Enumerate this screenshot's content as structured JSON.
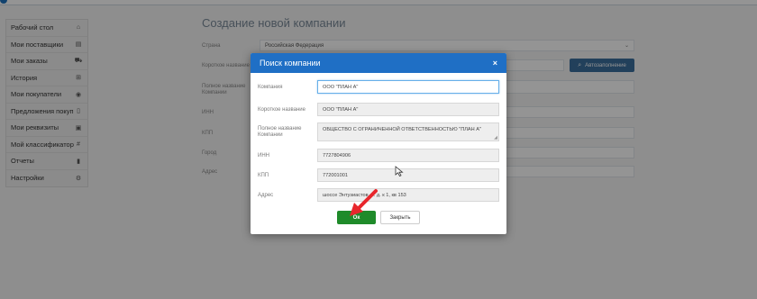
{
  "sidebar": {
    "items": [
      {
        "label": "Рабочий стол",
        "icon": "home-icon"
      },
      {
        "label": "Мои поставщики",
        "icon": "document-icon"
      },
      {
        "label": "Мои заказы",
        "icon": "cart-icon"
      },
      {
        "label": "История",
        "icon": "basket-icon"
      },
      {
        "label": "Мои покупатели",
        "icon": "eye-icon"
      },
      {
        "label": "Предложения покуп...",
        "icon": "file-icon"
      },
      {
        "label": "Мои реквизиты",
        "icon": "id-card-icon"
      },
      {
        "label": "Мой классификатор",
        "icon": "hash-icon"
      },
      {
        "label": "Отчеты",
        "icon": "report-icon"
      },
      {
        "label": "Настройки",
        "icon": "gears-icon"
      }
    ]
  },
  "page": {
    "title": "Создание новой компании",
    "labels": {
      "country": "Страна",
      "short_name": "Короткое название",
      "full_name": "Полное название Компании",
      "inn": "ИНН",
      "kpp": "КПП",
      "city": "Город",
      "address": "Адрес"
    },
    "country_value": "Российская Федерация",
    "autofill_button": "Автозаполнение"
  },
  "modal": {
    "title": "Поиск компании",
    "close_symbol": "×",
    "fields": {
      "company_label": "Компания",
      "company_value": "ООО \"ПЛАН А\"",
      "short_name_label": "Короткое название",
      "short_name_value": "ООО \"ПЛАН А\"",
      "full_name_label": "Полное название Компании",
      "full_name_value": "ОБЩЕСТВО С ОГРАНИЧЕННОЙ ОТВЕТСТВЕННОСТЬЮ \"ПЛАН А\"",
      "inn_label": "ИНН",
      "inn_value": "7727804906",
      "kpp_label": "КПП",
      "kpp_value": "772001001",
      "address_label": "Адрес",
      "address_value": "шоссе Энтузиастов, ... д. к 1, кв 153"
    },
    "ok_button": "Ок",
    "close_button": "Закрыть"
  },
  "colors": {
    "modal_header": "#1f6fc5",
    "ok_button": "#1f8b2a",
    "autofill_button": "#3c6f9e",
    "annotation_arrow": "#e8262c"
  }
}
